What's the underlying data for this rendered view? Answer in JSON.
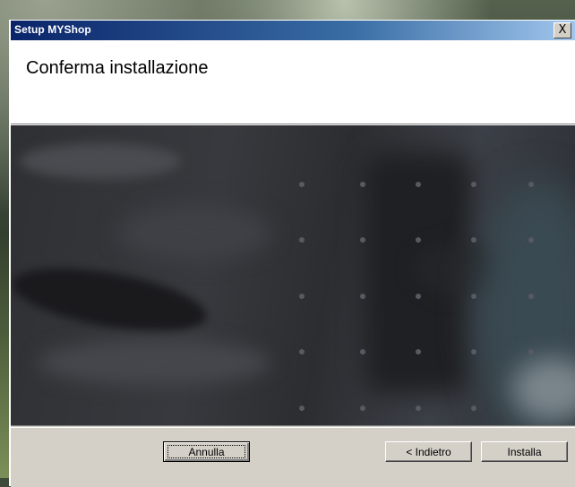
{
  "window": {
    "title": "Setup MYShop",
    "close_glyph": "X"
  },
  "header": {
    "title": "Conferma installazione"
  },
  "banner": {
    "image": "setup-banner-image"
  },
  "footer": {
    "cancel_label": "Annulla",
    "back_label": "< Indietro",
    "install_label": "Installa"
  },
  "colors": {
    "titlebar_start": "#0a246a",
    "titlebar_end": "#a6caf0",
    "dialog_face": "#d4d0c8"
  }
}
